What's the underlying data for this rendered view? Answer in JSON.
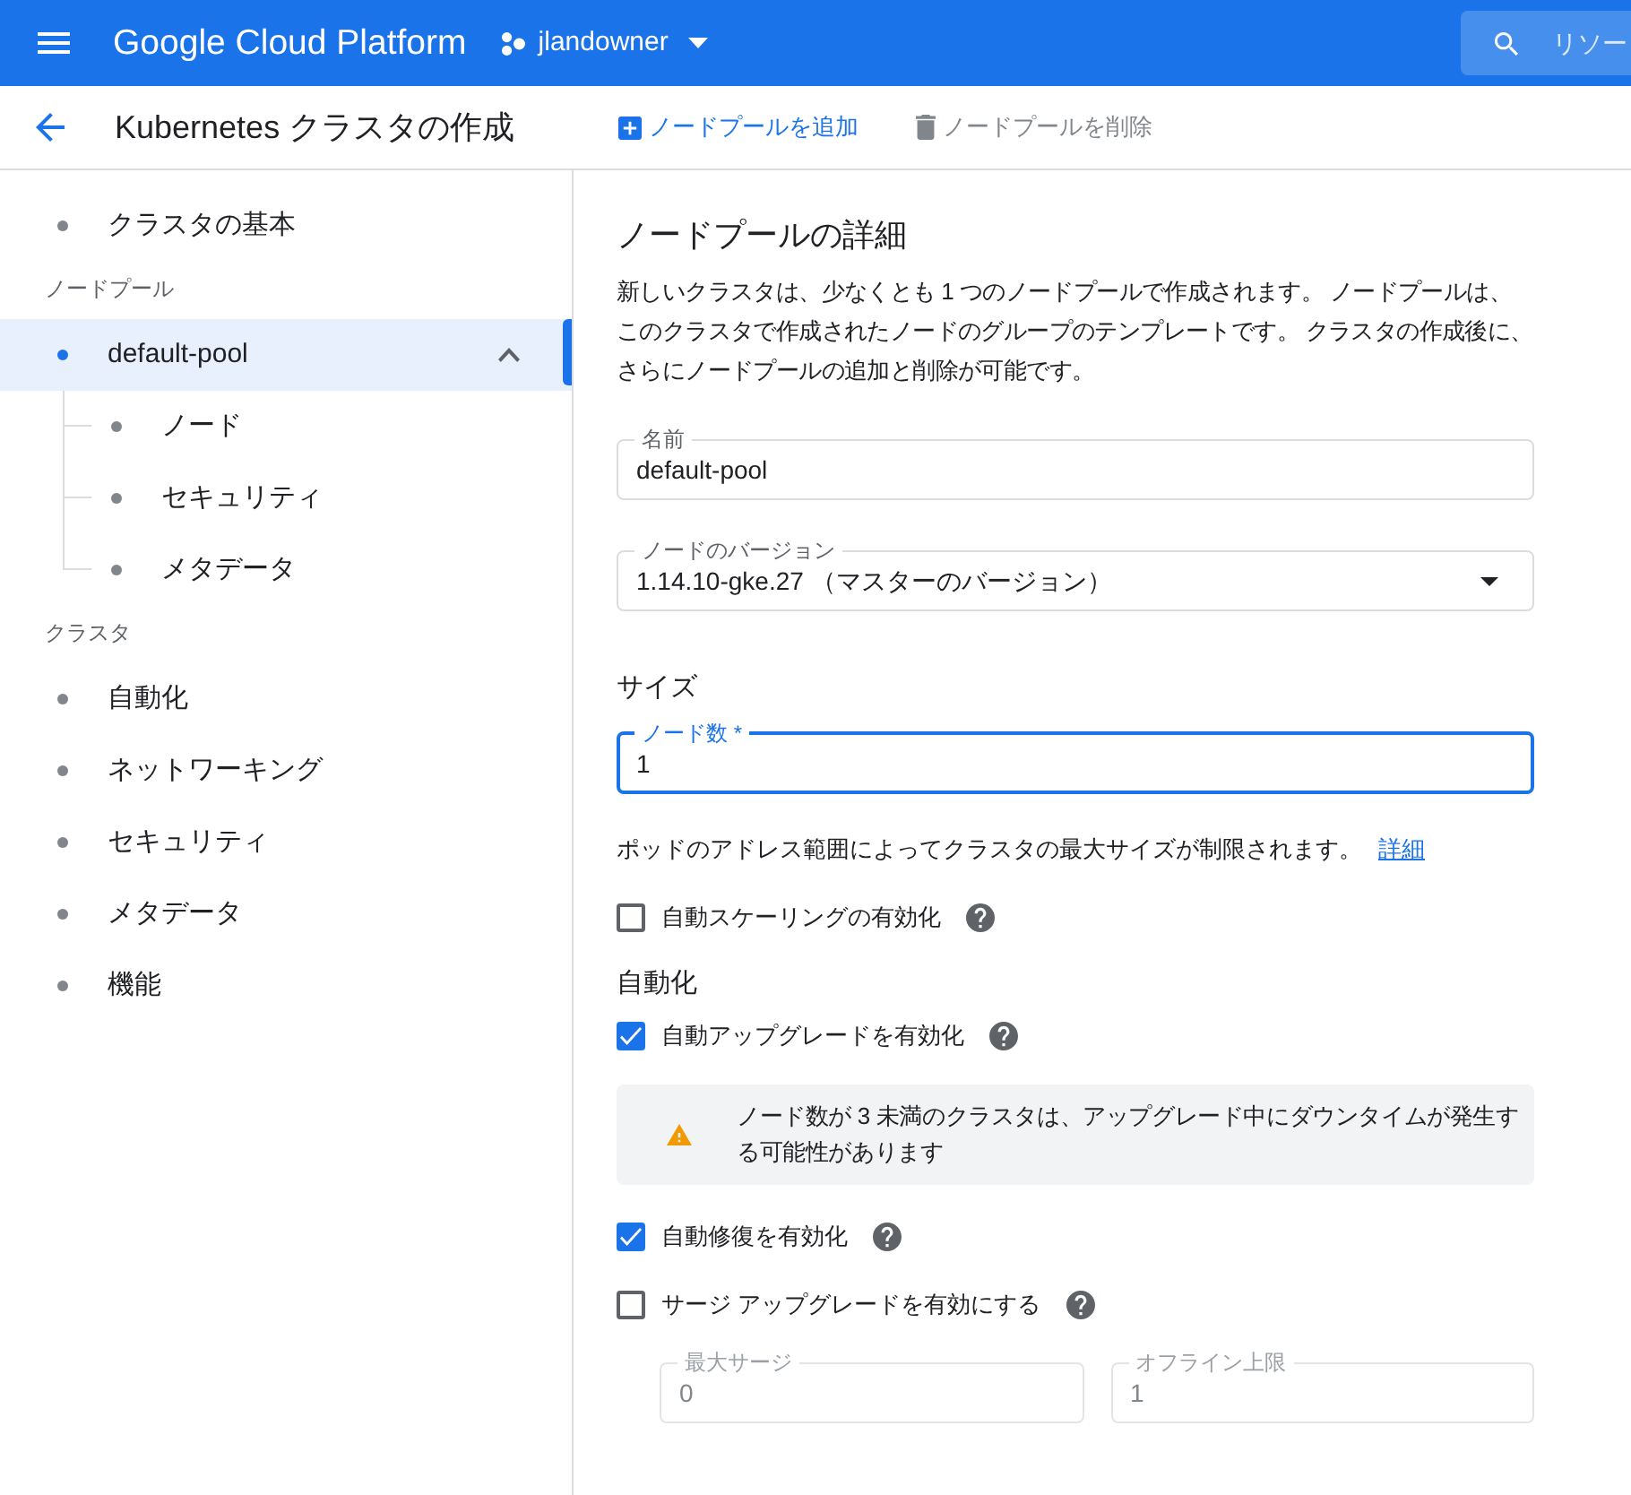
{
  "top_bar": {
    "product": "Google Cloud Platform",
    "project": "jlandowner",
    "search": {
      "placeholder": "リソー"
    }
  },
  "header": {
    "title": "Kubernetes クラスタの作成",
    "actions": [
      {
        "kind": "add",
        "label": "ノードプールを追加",
        "disabled": false
      },
      {
        "kind": "delete",
        "label": "ノードプールを削除",
        "disabled": true
      }
    ]
  },
  "sidebar": {
    "items": [
      {
        "kind": "item",
        "label": "クラスタの基本",
        "selected": false
      },
      {
        "kind": "section",
        "label": "ノードプール"
      },
      {
        "kind": "group",
        "label": "default-pool",
        "selected": true,
        "expanded": true,
        "children": [
          {
            "label": "ノード",
            "selected": false
          },
          {
            "label": "セキュリティ",
            "selected": false
          },
          {
            "label": "メタデータ",
            "selected": false
          }
        ]
      },
      {
        "kind": "section",
        "label": "クラスタ"
      },
      {
        "kind": "item",
        "label": "自動化",
        "selected": false
      },
      {
        "kind": "item",
        "label": "ネットワーキング",
        "selected": false
      },
      {
        "kind": "item",
        "label": "セキュリティ",
        "selected": false
      },
      {
        "kind": "item",
        "label": "メタデータ",
        "selected": false
      },
      {
        "kind": "item",
        "label": "機能",
        "selected": false
      }
    ]
  },
  "form": [
    {
      "kind": "title",
      "text": "ノードプールの詳細"
    },
    {
      "kind": "paragraph",
      "text": "新しいクラスタは、少なくとも 1 つのノードプールで作成されます。 ノードプールは、このクラスタで作成されたノードのグループのテンプレートです。 クラスタの作成後に、さらにノードプールの追加と削除が可能です。"
    },
    {
      "kind": "text_field",
      "label": "名前",
      "value": "default-pool",
      "focused": false
    },
    {
      "kind": "select",
      "label": "ノードのバージョン",
      "value": "1.14.10-gke.27 （マスターのバージョン）"
    },
    {
      "kind": "heading",
      "text": "サイズ"
    },
    {
      "kind": "text_field",
      "label": "ノード数 *",
      "value": "1",
      "focused": true
    },
    {
      "kind": "hint",
      "text": "ポッドのアドレス範囲によってクラスタの最大サイズが制限されます。",
      "link": "詳細"
    },
    {
      "kind": "checkbox",
      "label": "自動スケーリングの有効化",
      "checked": false
    },
    {
      "kind": "heading",
      "text": "自動化"
    },
    {
      "kind": "checkbox",
      "label": "自動アップグレードを有効化",
      "checked": true
    },
    {
      "kind": "warning",
      "text": "ノード数が 3 未満のクラスタは、アップグレード中にダウンタイムが発生する可能性があります"
    },
    {
      "kind": "checkbox",
      "label": "自動修復を有効化",
      "checked": true
    },
    {
      "kind": "checkbox",
      "label": "サージ アップグレードを有効にする",
      "checked": false
    },
    {
      "kind": "field_pair",
      "fields": [
        {
          "label": "最大サージ",
          "value": "0",
          "disabled": true
        },
        {
          "label": "オフライン上限",
          "value": "1",
          "disabled": true
        }
      ]
    }
  ]
}
